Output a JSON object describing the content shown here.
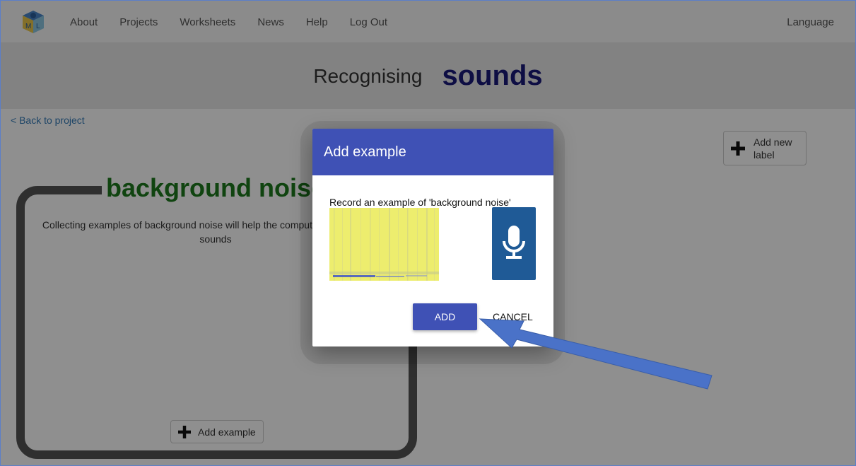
{
  "navbar": {
    "logo_letters": [
      "M",
      "L"
    ],
    "links": [
      "About",
      "Projects",
      "Worksheets",
      "News",
      "Help",
      "Log Out"
    ],
    "language": "Language"
  },
  "title": {
    "prefix": "Recognising",
    "main": "sounds"
  },
  "back_link": "< Back to project",
  "add_label_button": "Add new label",
  "label_card": {
    "title": "background noise",
    "description": "Collecting examples of background noise will help the computer recognize your sounds",
    "add_example_button": "Add example"
  },
  "dialog": {
    "title": "Add example",
    "prompt": "Record an example of 'background noise'",
    "add_button": "ADD",
    "cancel_button": "CANCEL"
  },
  "icons": {
    "plus": "plus-icon",
    "microphone": "microphone-icon",
    "arrow": "arrow-annotation"
  },
  "colors": {
    "dialog_header": "#3f51b5",
    "mic_button": "#1f5a96",
    "title_main": "#1a1a7a",
    "label_title": "#1e7a1e",
    "arrow": "#4a72c8",
    "spectrogram": "#eded6e"
  }
}
